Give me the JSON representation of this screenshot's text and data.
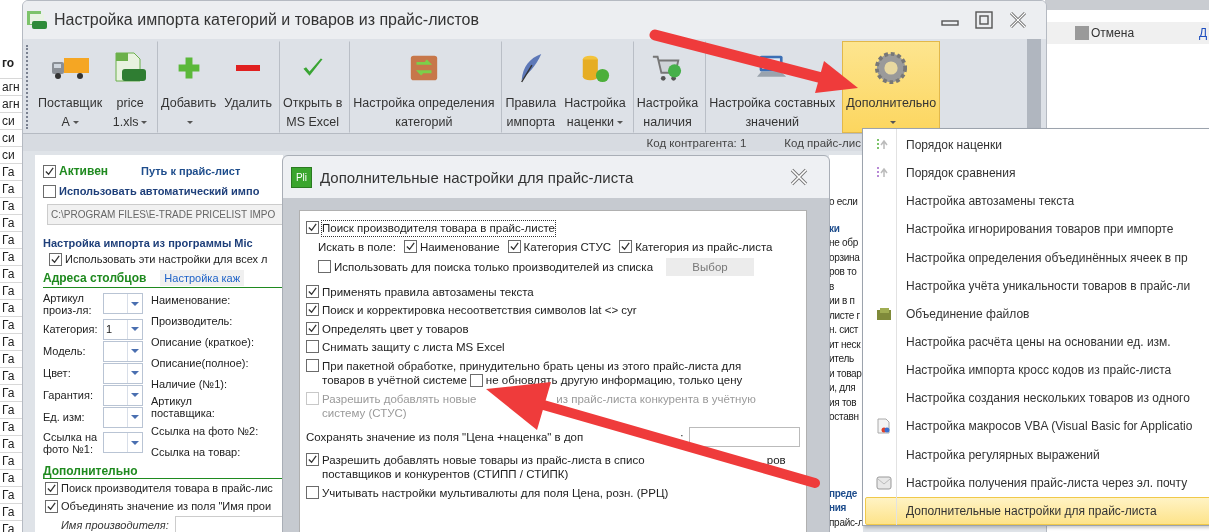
{
  "background": {
    "left_cells": [
      "го",
      "агн",
      "агн",
      "си",
      "си",
      "си",
      "Га",
      "Га",
      "Га",
      "Га",
      "Га",
      "Га",
      "Га",
      "Га",
      "Га",
      "Га",
      "Га",
      "Га",
      "Га",
      "Га",
      "Га",
      "Га",
      "Га",
      "Га",
      "Га",
      "Га",
      "Га",
      "Га"
    ],
    "window": {
      "cancel": "Отмена",
      "link": "Д"
    }
  },
  "window": {
    "title": "Настройка импорта категорий и товаров из прайс-листов"
  },
  "ribbon": [
    {
      "lines": [
        "Поставщик",
        "А"
      ],
      "caret": true,
      "separator_before": false,
      "selected": false
    },
    {
      "lines": [
        "price",
        "1.xls"
      ],
      "caret": true,
      "separator_before": false,
      "selected": false
    },
    {
      "lines": [
        "Добавить"
      ],
      "caret": true,
      "separator_before": true,
      "selected": false
    },
    {
      "lines": [
        "Удалить"
      ],
      "caret": false,
      "separator_before": false,
      "selected": false
    },
    {
      "lines": [
        "Открыть в",
        "MS Excel"
      ],
      "caret": false,
      "separator_before": true,
      "selected": false
    },
    {
      "lines": [
        "Настройка определения",
        "категорий"
      ],
      "caret": false,
      "separator_before": true,
      "selected": false
    },
    {
      "lines": [
        "Правила",
        "импорта"
      ],
      "caret": false,
      "separator_before": true,
      "selected": false
    },
    {
      "lines": [
        "Настройка",
        "наценки"
      ],
      "caret": true,
      "separator_before": false,
      "selected": false
    },
    {
      "lines": [
        "Настройка",
        "наличия"
      ],
      "caret": false,
      "separator_before": true,
      "selected": false
    },
    {
      "lines": [
        "Настройка составных",
        "значений"
      ],
      "caret": false,
      "separator_before": true,
      "selected": false
    },
    {
      "lines": [
        "Дополнительно"
      ],
      "caret": true,
      "separator_before": true,
      "selected": true
    }
  ],
  "status": [
    "Код контрагента: 1",
    "Код прайс-лис"
  ],
  "left_panel": {
    "active": {
      "label": "Активен",
      "checked": true
    },
    "path_title": "Путь к прайс-лист",
    "auto_import": {
      "label": "Использовать автоматический импо",
      "checked": false
    },
    "path_value": "C:\\PROGRAM FILES\\E-TRADE PRICELIST IMPO",
    "group_title": "Настройка импорта из программы Mic",
    "use_for_all": {
      "label": "Использовать эти настройки для всех л",
      "checked": true
    },
    "columns_title": "Адреса столбцов",
    "columns_link": "Настройка каж",
    "left_fields": [
      {
        "label": "Артикул произ-ля:"
      },
      {
        "label": "Категория:",
        "value": "1"
      },
      {
        "label": "Модель:"
      },
      {
        "label": "Цвет:"
      },
      {
        "label": "Гарантия:"
      },
      {
        "label": "Ед. изм:"
      },
      {
        "label": "Ссылка на фото №1:"
      }
    ],
    "right_fields": [
      "Наименование:",
      "Производитель:",
      "Описание (краткое):",
      "Описание(полное):",
      "Наличие (№1):",
      "Артикул поставщика:",
      "Ссылка на фото №2:",
      "Ссылка на товар:"
    ],
    "extra_title": "Дополнительно",
    "extra_checks": [
      {
        "label": "Поиск производителя товара в прайс-лис",
        "checked": true
      },
      {
        "label": "Объединять значение из поля \"Имя прои",
        "checked": true
      }
    ],
    "maker_label": "Имя производителя:"
  },
  "right_fragments": [
    {
      "kind": "text",
      "text": "о если"
    },
    {
      "kind": "header",
      "text": "ки"
    },
    {
      "kind": "text",
      "text": "не обр"
    },
    {
      "kind": "text",
      "text": "орзина"
    },
    {
      "kind": "text",
      "text": "ров то"
    },
    {
      "kind": "text",
      "text": "в"
    },
    {
      "kind": "text",
      "text": "ии в п"
    },
    {
      "kind": "text",
      "text": "листе г"
    },
    {
      "kind": "text",
      "text": "н. сист"
    },
    {
      "kind": "text",
      "text": "ит неск"
    },
    {
      "kind": "text",
      "text": "итель"
    },
    {
      "kind": "text",
      "text": "и товар"
    },
    {
      "kind": "text",
      "text": "и, для"
    },
    {
      "kind": "text",
      "text": "ия тов"
    },
    {
      "kind": "text",
      "text": "оставн"
    },
    {
      "kind": "header",
      "text": "преде"
    },
    {
      "kind": "header",
      "text": "ния"
    },
    {
      "kind": "text",
      "text": "прайс-л"
    }
  ],
  "dialog": {
    "logo": "Pli",
    "title": "Дополнительные настройки для прайс-листа",
    "rows": [
      {
        "kind": "check",
        "lines": [
          [
            "Поиск производителя товара в прайс-листе"
          ]
        ],
        "checked": true,
        "focused": true,
        "disabled": false
      },
      {
        "kind": "options",
        "label": "Искать в поле:",
        "options": [
          {
            "label": "Наименование",
            "checked": true
          },
          {
            "label": "Категория СТУС",
            "checked": true
          },
          {
            "label": "Категория из прайс-листа",
            "checked": true
          }
        ]
      },
      {
        "kind": "check-button",
        "label": "Использовать для поиска только производителей из списка",
        "checked": false,
        "button": "Выбор"
      },
      {
        "kind": "check",
        "lines": [
          [
            "Применять правила автозамены текста"
          ]
        ],
        "checked": true,
        "focused": false,
        "disabled": false
      },
      {
        "kind": "check",
        "lines": [
          [
            "Поиск и корректировка несоответствия символов lat <> cyr"
          ]
        ],
        "checked": true,
        "focused": false,
        "disabled": false
      },
      {
        "kind": "check",
        "lines": [
          [
            "Определять цвет у товаров"
          ]
        ],
        "checked": true,
        "focused": false,
        "disabled": false
      },
      {
        "kind": "check",
        "lines": [
          [
            "Снимать защиту с листа MS Excel"
          ]
        ],
        "checked": false,
        "focused": false,
        "disabled": false
      },
      {
        "kind": "check-sub",
        "label_lines": [
          "При пакетной обработке, принудительно брать цены из этого прайс-листа для",
          "товаров в учётной системе"
        ],
        "checked": false,
        "sub": {
          "label": "не обновлять другую информацию, только цену",
          "checked": false
        }
      },
      {
        "kind": "check",
        "lines": [
          [
            "Разрешить добавлять новые",
            "из прайс-листа конкурента в учётную"
          ],
          [
            "систему (СТУС)"
          ]
        ],
        "checked": false,
        "focused": false,
        "disabled": true
      },
      {
        "kind": "field",
        "parts": [
          "Сохранять значение из поля \"Цена +наценка\" в доп",
          ":"
        ]
      },
      {
        "kind": "check",
        "lines": [
          [
            "Разрешить добавлять новые товары из прайс-листа в списо",
            "ров"
          ],
          [
            "поставщиков и конкурентов (СТИПП / СТИПК)"
          ]
        ],
        "checked": true,
        "focused": false,
        "disabled": false
      },
      {
        "kind": "check",
        "lines": [
          [
            "Учитывать настройки мультивалюты для поля Цена, розн. (РРЦ)"
          ]
        ],
        "checked": false,
        "focused": false,
        "disabled": false
      }
    ]
  },
  "menu": [
    {
      "label": "Порядок наценки",
      "selected": false
    },
    {
      "label": "Порядок сравнения",
      "selected": false
    },
    {
      "label": "Настройка автозамены текста",
      "selected": false
    },
    {
      "label": "Настройка игнорирования товаров при импорте",
      "selected": false
    },
    {
      "label": "Настройка определения объединённых ячеек в пр",
      "selected": false
    },
    {
      "label": "Настройка учёта уникальности товаров в прайс-ли",
      "selected": false
    },
    {
      "label": "Объединение файлов",
      "selected": false
    },
    {
      "label": "Настройка расчёта цены на основании ед. изм.",
      "selected": false
    },
    {
      "label": "Настройка импорта кросс кодов из прайс-листа",
      "selected": false
    },
    {
      "label": "Настройка создания нескольких товаров из одного",
      "selected": false
    },
    {
      "label": "Настройка макросов VBA (Visual Basic for Applicatio",
      "selected": false
    },
    {
      "label": "Настройка регулярных выражений",
      "selected": false
    },
    {
      "label": "Настройка получения прайс-листа через эл. почту",
      "selected": false
    },
    {
      "label": "Дополнительные настройки для прайс-листа",
      "selected": true
    }
  ]
}
